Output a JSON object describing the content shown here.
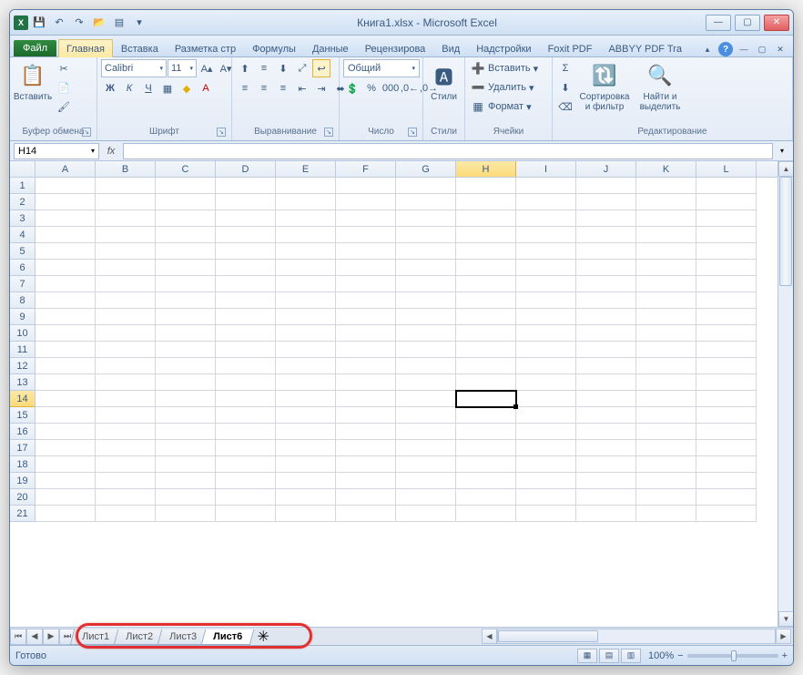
{
  "title": "Книга1.xlsx - Microsoft Excel",
  "qat_icon_text": "X",
  "ribbon_tabs": {
    "file": "Файл",
    "items": [
      "Главная",
      "Вставка",
      "Разметка стр",
      "Формулы",
      "Данные",
      "Рецензирова",
      "Вид",
      "Надстройки",
      "Foxit PDF",
      "ABBYY PDF Tra"
    ],
    "active_index": 0
  },
  "ribbon": {
    "clipboard": {
      "label": "Буфер обмена",
      "paste": "Вставить"
    },
    "font": {
      "label": "Шрифт",
      "name": "Calibri",
      "size": "11"
    },
    "align": {
      "label": "Выравнивание"
    },
    "number": {
      "label": "Число",
      "format": "Общий"
    },
    "styles": {
      "label": "Стили",
      "btn": "Стили"
    },
    "cells": {
      "label": "Ячейки",
      "insert": "Вставить",
      "delete": "Удалить",
      "format": "Формат"
    },
    "editing": {
      "label": "Редактирование",
      "sort": "Сортировка и фильтр",
      "find": "Найти и выделить"
    }
  },
  "namebox": "H14",
  "fx": "fx",
  "columns": [
    "A",
    "B",
    "C",
    "D",
    "E",
    "F",
    "G",
    "H",
    "I",
    "J",
    "K",
    "L"
  ],
  "rows_count": 21,
  "active": {
    "row": 14,
    "col": "H"
  },
  "sheets": [
    "Лист1",
    "Лист2",
    "Лист3",
    "Лист6"
  ],
  "active_sheet": 3,
  "status": "Готово",
  "zoom": "100%"
}
